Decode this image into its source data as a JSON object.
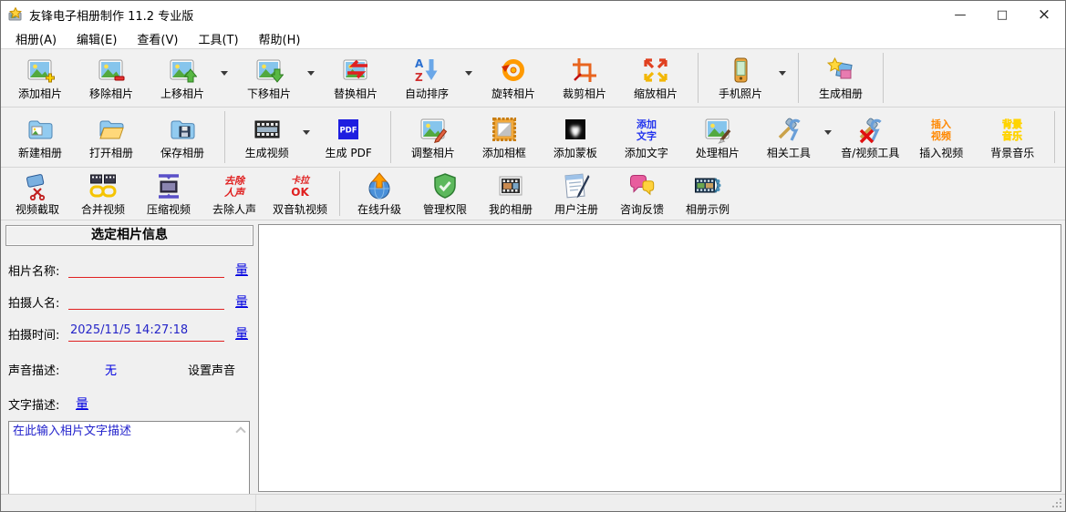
{
  "window": {
    "title": "友锋电子相册制作 11.2 专业版",
    "controls": {
      "minimize": "—",
      "maximize": "□",
      "close": "×"
    }
  },
  "menu": {
    "items": [
      {
        "name": "menu-album",
        "label": "相册(A)"
      },
      {
        "name": "menu-edit",
        "label": "编辑(E)"
      },
      {
        "name": "menu-view",
        "label": "查看(V)"
      },
      {
        "name": "menu-tools",
        "label": "工具(T)"
      },
      {
        "name": "menu-help",
        "label": "帮助(H)"
      }
    ]
  },
  "toolbars": [
    {
      "items": [
        {
          "name": "add-photo",
          "icon": "add-photo",
          "label": "添加相片"
        },
        {
          "name": "remove-photo",
          "icon": "remove-photo",
          "label": "移除相片"
        },
        {
          "name": "move-up-photo",
          "icon": "move-up-photo",
          "label": "上移相片",
          "dropdown": true
        },
        {
          "name": "move-down-photo",
          "icon": "move-down-photo",
          "label": "下移相片",
          "dropdown": true
        },
        {
          "name": "replace-photo",
          "icon": "replace-photo",
          "label": "替换相片"
        },
        {
          "name": "auto-sort",
          "icon": "auto-sort",
          "label": "自动排序",
          "dropdown": true
        },
        {
          "name": "rotate-photo",
          "icon": "rotate-photo",
          "label": "旋转相片"
        },
        {
          "name": "crop-photo",
          "icon": "crop-photo",
          "label": "裁剪相片"
        },
        {
          "name": "scale-photo",
          "icon": "scale-photo",
          "label": "缩放相片"
        },
        {
          "type": "sep"
        },
        {
          "name": "phone-photos",
          "icon": "phone-photos",
          "label": "手机照片",
          "dropdown": true
        },
        {
          "type": "sep"
        },
        {
          "name": "generate-album",
          "icon": "generate-album",
          "label": "生成相册"
        },
        {
          "type": "sep"
        }
      ]
    },
    {
      "items": [
        {
          "name": "new-album",
          "icon": "new-album",
          "label": "新建相册"
        },
        {
          "name": "open-album",
          "icon": "open-album",
          "label": "打开相册"
        },
        {
          "name": "save-album",
          "icon": "save-album",
          "label": "保存相册"
        },
        {
          "type": "sep"
        },
        {
          "name": "generate-video",
          "icon": "generate-video",
          "label": "生成视频",
          "dropdown": true
        },
        {
          "name": "generate-pdf",
          "icon": "generate-pdf",
          "label": "生成 PDF"
        },
        {
          "type": "sep"
        },
        {
          "name": "adjust-photo",
          "icon": "adjust-photo",
          "label": "调整相片"
        },
        {
          "name": "add-frame",
          "icon": "add-frame",
          "label": "添加相框"
        },
        {
          "name": "add-mask",
          "icon": "add-mask",
          "label": "添加蒙板"
        },
        {
          "name": "add-text",
          "icon": "add-text",
          "label": "添加文字"
        },
        {
          "name": "process-photo",
          "icon": "process-photo",
          "label": "处理相片"
        },
        {
          "name": "related-tools",
          "icon": "related-tools",
          "label": "相关工具",
          "dropdown": true
        },
        {
          "name": "av-tools",
          "icon": "av-tools",
          "label": "音/视频工具"
        },
        {
          "name": "insert-video",
          "icon": "insert-video",
          "label": "插入视频"
        },
        {
          "name": "background-music",
          "icon": "background-music",
          "label": "背景音乐"
        },
        {
          "type": "sep"
        }
      ]
    },
    {
      "items": [
        {
          "name": "video-capture",
          "icon": "video-capture",
          "label": "视频截取"
        },
        {
          "name": "merge-video",
          "icon": "merge-video",
          "label": "合并视频"
        },
        {
          "name": "compress-video",
          "icon": "compress-video",
          "label": "压缩视频"
        },
        {
          "name": "remove-vocal",
          "icon": "remove-vocal",
          "label": "去除人声"
        },
        {
          "name": "dual-track-video",
          "icon": "dual-track-video",
          "label": "双音轨视频"
        },
        {
          "type": "sep"
        },
        {
          "name": "online-upgrade",
          "icon": "online-upgrade",
          "label": "在线升级"
        },
        {
          "name": "manage-permissions",
          "icon": "manage-permissions",
          "label": "管理权限"
        },
        {
          "name": "my-albums",
          "icon": "my-albums",
          "label": "我的相册"
        },
        {
          "name": "user-register",
          "icon": "user-register",
          "label": "用户注册"
        },
        {
          "name": "feedback",
          "icon": "feedback",
          "label": "咨询反馈"
        },
        {
          "name": "album-examples",
          "icon": "album-examples",
          "label": "相册示例"
        }
      ]
    }
  ],
  "sidebar": {
    "header": "选定相片信息",
    "fields": [
      {
        "label": "相片名称:",
        "value": "",
        "link": "量"
      },
      {
        "label": "拍摄人名:",
        "value": "",
        "link": "量"
      },
      {
        "label": "拍摄时间:",
        "value": "2025/11/5 14:27:18",
        "link": "量"
      }
    ],
    "sound_row": {
      "label": "声音描述:",
      "value": "无",
      "action": "设置声音"
    },
    "text_row": {
      "label": "文字描述:",
      "link": "量"
    },
    "textarea_value": "在此输入相片文字描述"
  },
  "colors": {
    "field_underline": "#e02020",
    "link_blue": "#0000e0",
    "value_blue": "#2525c8",
    "toolbar_bg": "#f1f1f1"
  }
}
